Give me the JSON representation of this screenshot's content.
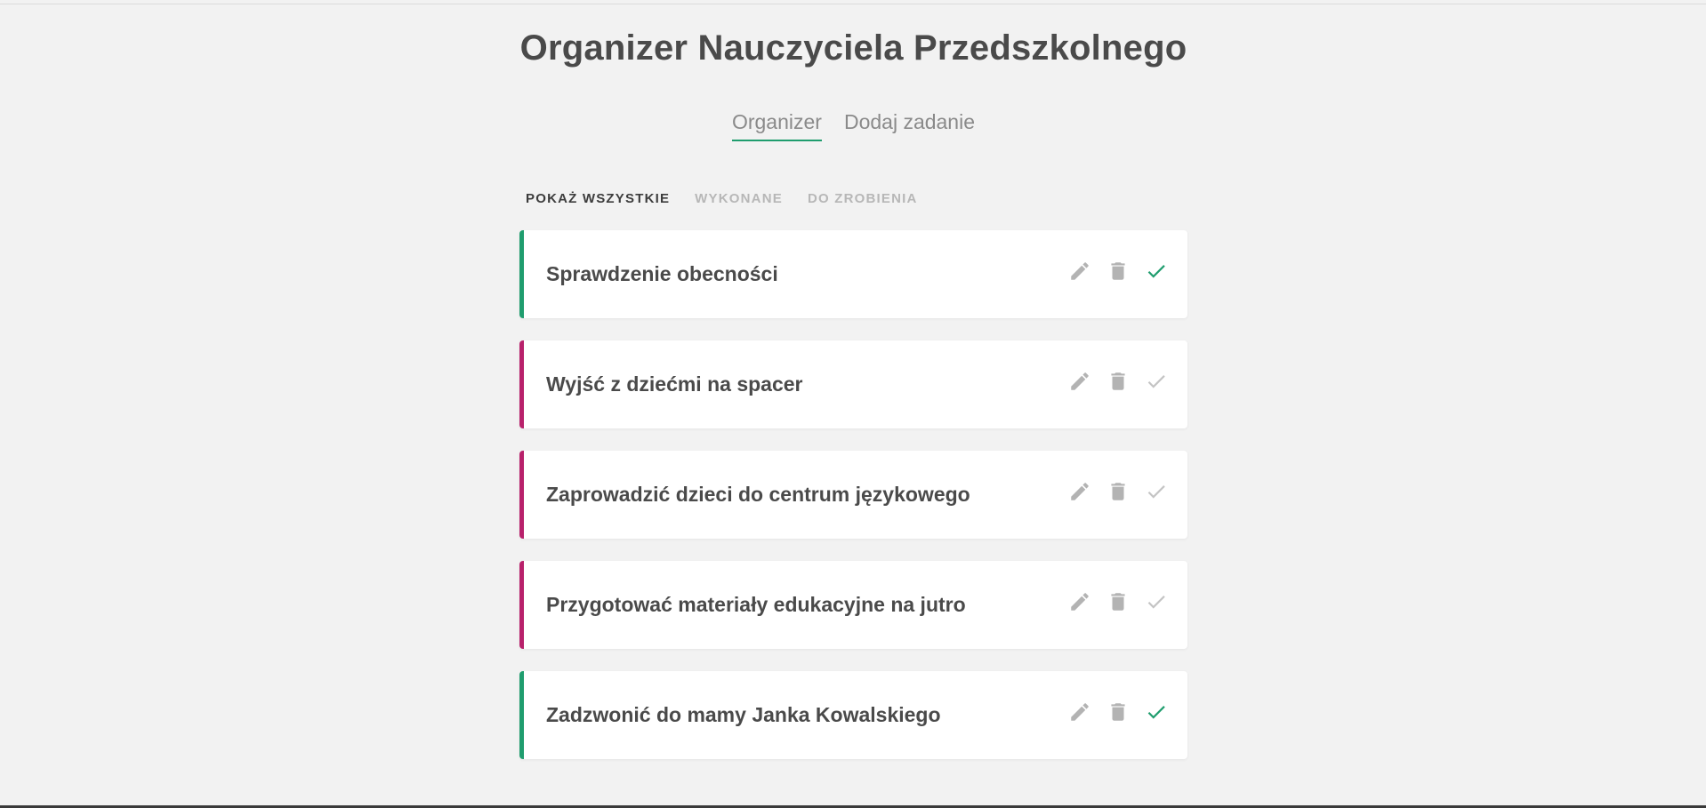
{
  "app": {
    "title": "Organizer Nauczyciela Przedszkolnego"
  },
  "nav": {
    "tabs": [
      {
        "label": "Organizer",
        "active": true
      },
      {
        "label": "Dodaj zadanie",
        "active": false
      }
    ]
  },
  "filters": [
    {
      "label": "POKAŻ WSZYSTKIE",
      "active": true
    },
    {
      "label": "WYKONANE",
      "active": false
    },
    {
      "label": "DO ZROBIENIA",
      "active": false
    }
  ],
  "tasks": [
    {
      "label": "Sprawdzenie obecności",
      "done": true
    },
    {
      "label": "Wyjść z dziećmi na spacer",
      "done": false
    },
    {
      "label": "Zaprowadzić dzieci do centrum językowego",
      "done": false
    },
    {
      "label": "Przygotować materiały edukacyjne na jutro",
      "done": false
    },
    {
      "label": "Zadzwonić do mamy Janka Kowalskiego",
      "done": true
    }
  ],
  "icons": {
    "edit": "pencil-icon",
    "delete": "trash-icon",
    "complete": "check-icon"
  },
  "colors": {
    "accent": "#1f9d6e",
    "todo": "#b8216b",
    "icon_gray": "#b3b3b3"
  }
}
